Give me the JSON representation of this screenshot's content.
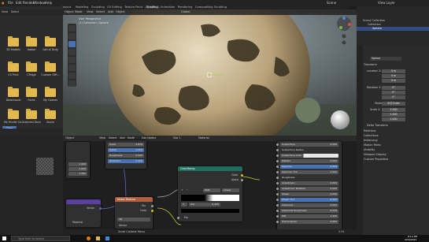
{
  "menubar": {
    "items": [
      "File",
      "Edit",
      "Render",
      "Window",
      "Help"
    ],
    "scene": "Scene",
    "view_layer": "View Layer"
  },
  "workspace_tabs": [
    "Layout",
    "Modeling",
    "Sculpting",
    "UV Editing",
    "Texture Paint",
    "Shading",
    "Animation",
    "Rendering",
    "Compositing",
    "Scripting"
  ],
  "active_tab": "Shading",
  "viewport": {
    "header": [
      "Object Mode",
      "View",
      "Select",
      "Add",
      "Object"
    ],
    "transform": "Global",
    "info_line1": "User Perspective",
    "info_line2": "(1) Collection | Sphere"
  },
  "file_browser": {
    "items": [
      {
        "label": "3D Models"
      },
      {
        "label": "Adobe"
      },
      {
        "label": "Call of Duty"
      },
      {
        "label": "CS Print"
      },
      {
        "label": "CPaige"
      },
      {
        "label": "Custom Offi..."
      },
      {
        "label": "Downloads"
      },
      {
        "label": "Fonts"
      },
      {
        "label": "My Games"
      },
      {
        "label": "My Kindle Co..."
      },
      {
        "label": "Scanned Docs"
      },
      {
        "label": "Zoom"
      }
    ],
    "open_button": "Open"
  },
  "outliner": {
    "title": "Scene Collection",
    "rows": [
      "Collection",
      "Sphere"
    ]
  },
  "properties": {
    "object_name": "Sphere",
    "section_transform": "Transform",
    "location_label": "Location X",
    "location": [
      "0 m",
      "0 m",
      "0 m"
    ],
    "rotation_label": "Rotation X",
    "rotation": [
      "0°",
      "0°",
      "0°"
    ],
    "mode_label": "Mode",
    "mode": "XYZ Euler",
    "scale_label": "Scale X",
    "scale": [
      "1.000",
      "1.000",
      "1.000"
    ],
    "delta": "Delta Transform",
    "sections": [
      "Relations",
      "Collections",
      "Instancing",
      "Motion Paths",
      "Visibility",
      "Viewport Display",
      "Custom Properties"
    ]
  },
  "node_editor": {
    "header": [
      "Object",
      "View",
      "Select",
      "Add",
      "Node",
      "Use Nodes",
      "Slot 1",
      "Material"
    ],
    "mapping_node": {
      "fields": [
        {
          "label": "Scale",
          "value": "2.876"
        },
        {
          "label": "Detail",
          "value": "2.000"
        },
        {
          "label": "Roughness",
          "value": "0.500"
        },
        {
          "label": "Distortion",
          "value": "0.000"
        }
      ],
      "extra_values": [
        "1.000",
        "1.000",
        "1.000"
      ]
    },
    "colorramp_node": {
      "title": "ColorRamp",
      "outputs": [
        "Color",
        "Alpha"
      ],
      "mode": "RGB",
      "interp": "Linear",
      "pos_label": "Pos",
      "pos_value": "0.455",
      "input": "Fac",
      "index": "1"
    },
    "noise_node": {
      "title": "Noise Texture",
      "outputs": [
        "Fac",
        "Color"
      ],
      "dim": "3D",
      "input": "Vector"
    },
    "vector_node": {
      "output": "Vector",
      "label": "Material"
    },
    "bsdf_node": {
      "rows": [
        {
          "label": "Subsurface",
          "value": "0.000",
          "blue": false
        },
        {
          "label": "Subsurface Radius",
          "value": "",
          "blue": false
        },
        {
          "label": "Subsurface Color",
          "value": "",
          "blue": false
        },
        {
          "label": "Metallic",
          "value": "0.000",
          "blue": false
        },
        {
          "label": "Specular",
          "value": "0.500",
          "blue": true
        },
        {
          "label": "Specular Tint",
          "value": "0.000",
          "blue": false
        },
        {
          "label": "Roughness",
          "value": "",
          "blue": false
        },
        {
          "label": "Anisotropic",
          "value": "0.000",
          "blue": false
        },
        {
          "label": "Anisotropic Rotation",
          "value": "0.000",
          "blue": false
        },
        {
          "label": "Sheen",
          "value": "0.000",
          "blue": false
        },
        {
          "label": "Sheen Tint",
          "value": "0.500",
          "blue": true
        },
        {
          "label": "Clearcoat",
          "value": "0.000",
          "blue": false
        },
        {
          "label": "Clearcoat Roughness",
          "value": "0.030",
          "blue": false
        },
        {
          "label": "IOR",
          "value": "1.450",
          "blue": false
        },
        {
          "label": "Transmission",
          "value": "0.000",
          "blue": false
        }
      ]
    }
  },
  "statusbar": {
    "hint": "Scroll Context Menu",
    "version": "2.91"
  },
  "taskbar": {
    "search_placeholder": "Type here to search",
    "time": "8:14 PM",
    "date": "4/16/2021"
  },
  "colors": {
    "accent": "#4772b3",
    "folder": "#e1b94e",
    "shader_header": "#1f6b5c",
    "texture_header": "#b0603e",
    "vector_header": "#5b3f9e"
  }
}
